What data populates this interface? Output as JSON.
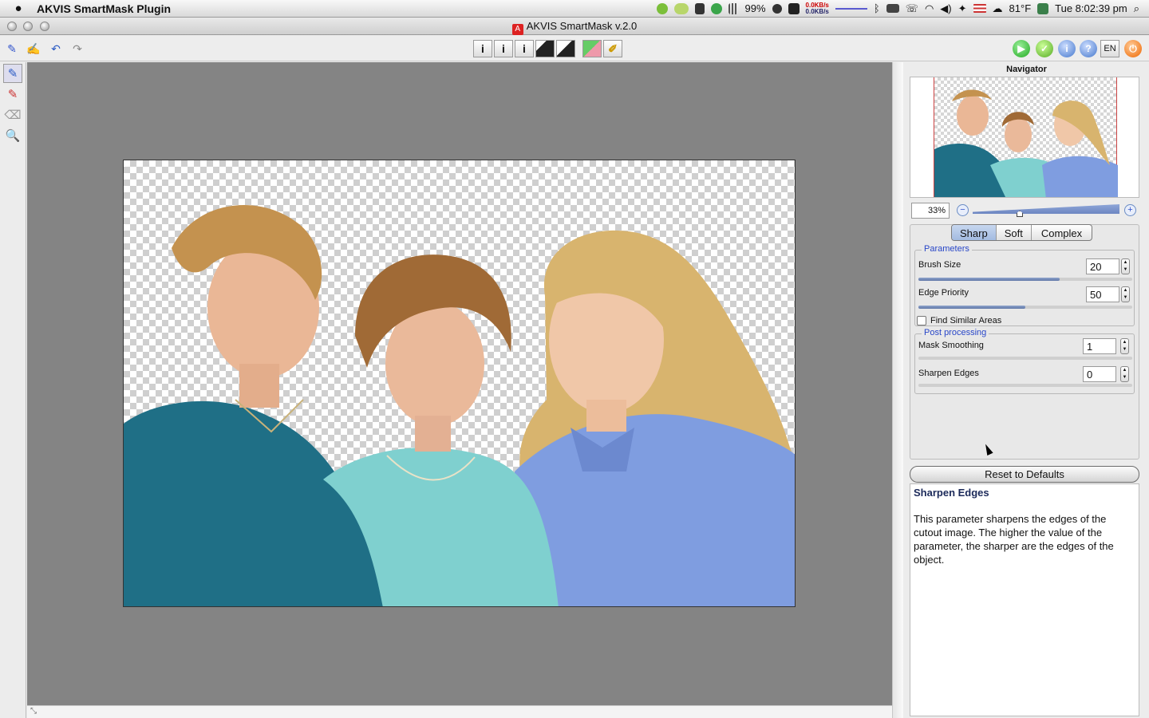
{
  "menubar": {
    "app_name": "AKVIS SmartMask Plugin",
    "battery": "99%",
    "net_up": "0.0KB/s",
    "net_down": "0.0KB/s",
    "temperature": "81°F",
    "clock": "Tue 8:02:39 pm"
  },
  "window": {
    "title": "AKVIS SmartMask v.2.0"
  },
  "toolbar": {
    "mode_buttons": [
      "i",
      "i",
      "i",
      "",
      "",
      "",
      ""
    ],
    "language": "EN"
  },
  "navigator": {
    "label": "Navigator",
    "zoom_value": "33%",
    "zoom_level_fraction": 0.31
  },
  "settings": {
    "tabs": [
      "Sharp",
      "Soft",
      "Complex"
    ],
    "active_tab": "Sharp",
    "parameters_title": "Parameters",
    "brush_size": {
      "label": "Brush Size",
      "value": "20",
      "fraction": 0.66
    },
    "edge_priority": {
      "label": "Edge Priority",
      "value": "50",
      "fraction": 0.5
    },
    "find_similar_label": "Find Similar Areas",
    "find_similar_checked": false,
    "post_title": "Post processing",
    "mask_smoothing": {
      "label": "Mask Smoothing",
      "value": "1",
      "fraction": 0.0
    },
    "sharpen_edges": {
      "label": "Sharpen Edges",
      "value": "0",
      "fraction": 0.0
    }
  },
  "reset_label": "Reset to Defaults",
  "help": {
    "title": "Sharpen Edges",
    "text": "This parameter sharpens the edges of the cutout image. The higher the value of the parameter, the sharper are the edges of the object."
  },
  "colors": {
    "accent": "#5f76a8",
    "group_title": "#2846c8",
    "canvas_bg": "#848484",
    "shirt_teal": "#1f6f86",
    "shirt_aqua": "#7fd0cf",
    "shirt_blue": "#7f9de0"
  }
}
